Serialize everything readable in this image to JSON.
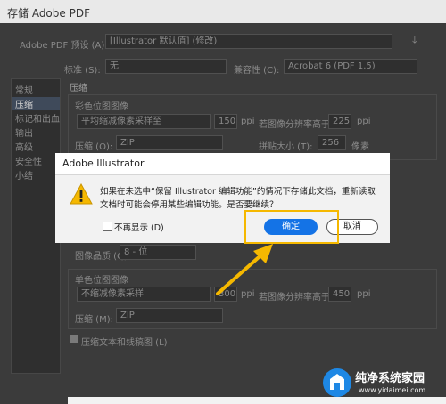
{
  "window": {
    "title": "存储 Adobe PDF"
  },
  "preset": {
    "label": "Adobe PDF 预设 (A):",
    "value": "[Illustrator 默认值] (修改)"
  },
  "standard": {
    "label": "标准 (S):",
    "value": "无"
  },
  "compat": {
    "label": "兼容性 (C):",
    "value": "Acrobat 6 (PDF 1.5)"
  },
  "sidebar": {
    "items": [
      "常规",
      "压缩",
      "标记和出血",
      "输出",
      "高级",
      "安全性",
      "小结"
    ]
  },
  "compression": {
    "section": "压缩",
    "color_group": "彩色位图图像",
    "color_downsample": "平均缩减像素采样至",
    "color_ppi": "150",
    "ppi": "ppi",
    "above_label": "若图像分辨率高于 (G)",
    "color_above": "225",
    "compress_label": "压缩 (O):",
    "color_compress": "ZIP",
    "tile_label": "拼贴大小 (T):",
    "tile_value": "256",
    "pixel": "像素",
    "quality_label": "图像品质 (Q):",
    "quality_value": "8 - 位",
    "mono_group": "单色位图图像",
    "mono_downsample": "不缩减像素采样",
    "mono_ppi": "300",
    "mono_above_label": "若图像分辨率高于 (B)",
    "mono_above": "450",
    "mono_compress_label": "压缩 (M):",
    "mono_compress": "ZIP",
    "compress_text": "压缩文本和线稿图 (L)"
  },
  "dialog": {
    "title": "Adobe Illustrator",
    "message": "如果在未选中“保留 Illustrator 编辑功能”的情况下存储此文档，重新读取文档时可能会停用某些编辑功能。是否要继续？",
    "checkbox_label": "不再显示 (D)",
    "ok_label": "确定",
    "cancel_label": "取消"
  },
  "watermark": {
    "text": "纯净系统家园",
    "url": "www.yidaimei.com"
  },
  "colors": {
    "accent": "#1473e6",
    "highlight": "#f5b800",
    "warning": "#f5b800"
  }
}
